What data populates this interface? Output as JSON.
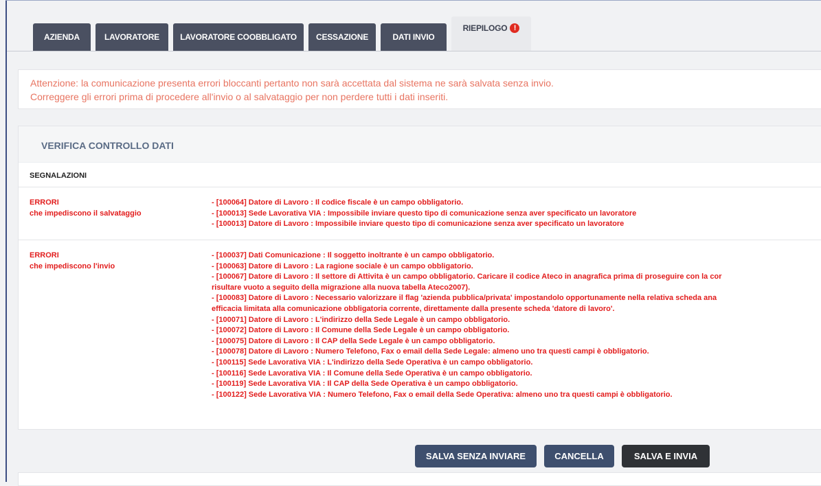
{
  "tabs": [
    {
      "label": "AZIENDA"
    },
    {
      "label": "LAVORATORE"
    },
    {
      "label": "LAVORATORE COOBBLIGATO"
    },
    {
      "label": "CESSAZIONE"
    },
    {
      "label": "DATI INVIO"
    },
    {
      "label": "RIEPILOGO",
      "alert_icon": "!"
    }
  ],
  "warning": {
    "line1": "Attenzione: la comunicazione presenta errori bloccanti pertanto non sarà accettata dal sistema ne sarà salvata senza invio.",
    "line2": "Correggere gli errori prima di procedere all'invio o al salvataggio per non perdere tutti i dati inseriti."
  },
  "panel": {
    "title": "VERIFICA CONTROLLO DATI",
    "section": "SEGNALAZIONI",
    "groups": [
      {
        "title": "ERRORI",
        "subtitle": "che impediscono il salvataggio",
        "items": [
          "- [100064] Datore di Lavoro : Il codice fiscale è un campo obbligatorio.",
          "- [100013] Sede Lavorativa VIA : Impossibile inviare questo tipo di comunicazione senza aver specificato un lavoratore",
          "- [100013] Datore di Lavoro : Impossibile inviare questo tipo di comunicazione senza aver specificato un lavoratore"
        ]
      },
      {
        "title": "ERRORI",
        "subtitle": "che impediscono l'invio",
        "items": [
          "- [100037] Dati Comunicazione : Il soggetto inoltrante è un campo obbligatorio.",
          "- [100063] Datore di Lavoro : La ragione sociale è un campo obbligatorio.",
          "- [100067] Datore di Lavoro : Il settore di Attivita è un campo obbligatorio. Caricare il codice Ateco in anagrafica prima di proseguire con la cor",
          "risultare vuoto a seguito della migrazione alla nuova tabella Ateco2007).",
          "- [100083] Datore di Lavoro : Necessario valorizzare il flag 'azienda pubblica/privata' impostandolo opportunamente nella relativa scheda ana",
          "efficacia limitata alla comunicazione obbligatoria corrente, direttamente dalla presente scheda 'datore di lavoro'.",
          "- [100071] Datore di Lavoro : L'indirizzo della Sede Legale è un campo obbligatorio.",
          "- [100072] Datore di Lavoro : Il Comune della Sede Legale è un campo obbligatorio.",
          "- [100075] Datore di Lavoro : Il CAP della Sede Legale è un campo obbligatorio.",
          "- [100078] Datore di Lavoro : Numero Telefono, Fax o email della Sede Legale: almeno uno tra questi campi è obbligatorio.",
          "- [100115] Sede Lavorativa VIA : L'indirizzo della Sede Operativa è un campo obbligatorio.",
          "- [100116] Sede Lavorativa VIA : Il Comune della Sede Operativa è un campo obbligatorio.",
          "- [100119] Sede Lavorativa VIA : Il CAP della Sede Operativa è un campo obbligatorio.",
          "- [100122] Sede Lavorativa VIA : Numero Telefono, Fax o email della Sede Operativa: almeno uno tra questi campi è obbligatorio."
        ]
      }
    ]
  },
  "buttons": {
    "save_no_send": "SALVA SENZA INVIARE",
    "cancel": "CANCELLA",
    "save_send": "SALVA E INVIA"
  }
}
